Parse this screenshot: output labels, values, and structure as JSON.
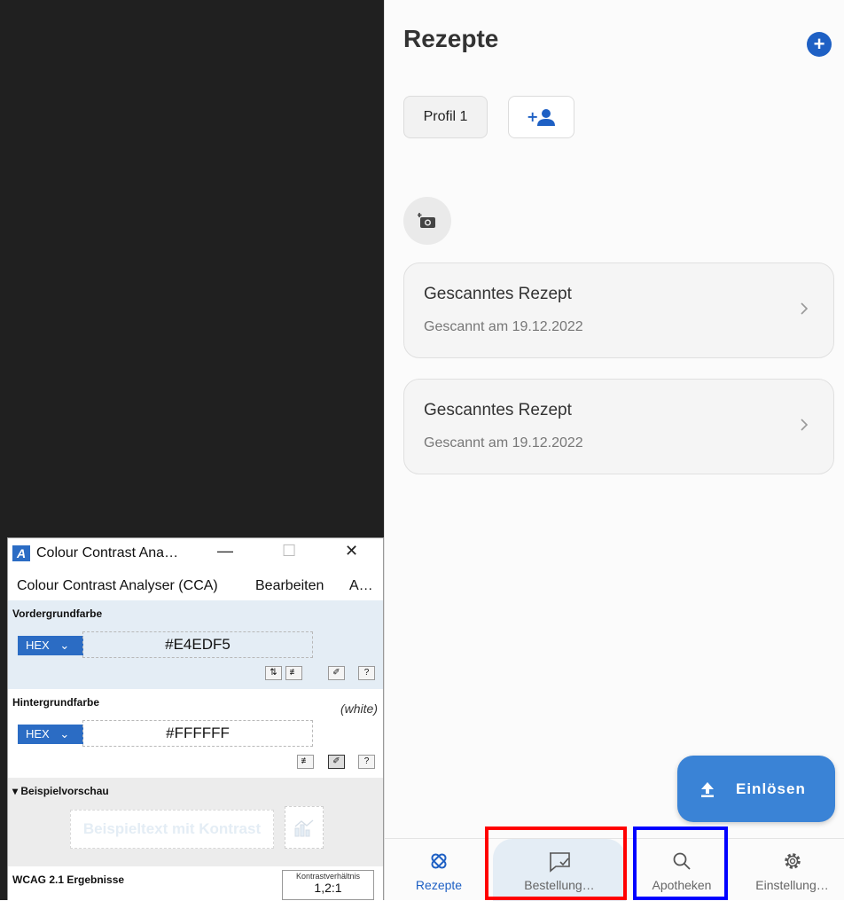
{
  "app": {
    "title": "Rezepte",
    "profile_chip": "Profil 1",
    "cards": [
      {
        "title": "Gescanntes Rezept",
        "subtitle": "Gescannt am 19.12.2022"
      },
      {
        "title": "Gescanntes Rezept",
        "subtitle": "Gescannt am 19.12.2022"
      }
    ],
    "fab_label": "Einlösen",
    "nav": [
      {
        "label": "Rezepte",
        "icon": "prescription-icon",
        "active": true
      },
      {
        "label": "Bestellung…",
        "icon": "chat-check-icon",
        "active": false
      },
      {
        "label": "Apotheken",
        "icon": "search-icon",
        "active": false
      },
      {
        "label": "Einstellung…",
        "icon": "gear-icon",
        "active": false
      }
    ],
    "colors": {
      "accent": "#1e60c4",
      "fab": "#3a83d6",
      "highlight": "#e4edf5",
      "red_marker": "#ff0000",
      "blue_marker": "#0000ff"
    }
  },
  "cca": {
    "window_title": "Colour Contrast Ana…",
    "menu": [
      "Colour Contrast Analyser (CCA)",
      "Bearbeiten",
      "A…"
    ],
    "foreground": {
      "heading": "Vordergrundfarbe",
      "format": "HEX",
      "value": "#E4EDF5"
    },
    "background": {
      "heading": "Hintergrundfarbe",
      "note": "(white)",
      "format": "HEX",
      "value": "#FFFFFF"
    },
    "preview": {
      "heading": "▾ Beispielvorschau",
      "sample_text": "Beispieltext mit Kontrast"
    },
    "wcag": {
      "heading": "WCAG 2.1 Ergebnisse",
      "ratio_label": "Kontrastverhältnis",
      "ratio_value": "1,2:1"
    }
  }
}
